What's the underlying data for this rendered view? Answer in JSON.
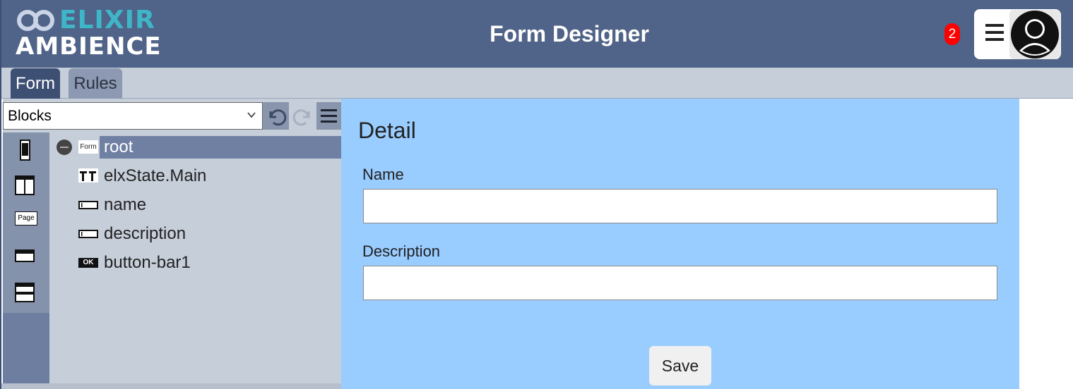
{
  "header": {
    "logo_line1": "ELIXIR",
    "logo_line2": "AMBIENCE",
    "title": "Form Designer",
    "notification_count": "2",
    "menu_icon": "hamburger-icon",
    "avatar_icon": "user-avatar-icon"
  },
  "tabs": [
    {
      "label": "Form",
      "active": true
    },
    {
      "label": "Rules",
      "active": false
    }
  ],
  "left_panel": {
    "blocks_select": {
      "value": "Blocks"
    },
    "toolbar": [
      "undo-icon",
      "redo-icon",
      "menu-icon"
    ],
    "palette": [
      "phone-layout-icon",
      "two-column-icon",
      "page-icon",
      "single-row-icon",
      "two-row-icon"
    ],
    "palette_page_label": "Page",
    "tree": [
      {
        "label": "root",
        "icon": "form-icon",
        "icon_text": "Form",
        "selected": true
      },
      {
        "label": "elxState.Main",
        "icon": "state-icon",
        "selected": false
      },
      {
        "label": "name",
        "icon": "textbox-icon",
        "selected": false
      },
      {
        "label": "description",
        "icon": "textbox-icon",
        "selected": false
      },
      {
        "label": "button-bar1",
        "icon": "button-bar-icon",
        "icon_text": "OK",
        "selected": false
      }
    ]
  },
  "canvas": {
    "title": "Detail",
    "fields": [
      {
        "label": "Name",
        "value": ""
      },
      {
        "label": "Description",
        "value": ""
      }
    ],
    "save_label": "Save"
  },
  "colors": {
    "header_bg": "#506388",
    "accent": "#3fb6c8",
    "tab_active": "#3d4f73",
    "canvas_bg": "#99ccff",
    "selection": "#7080a3",
    "badge": "#ff0000"
  }
}
